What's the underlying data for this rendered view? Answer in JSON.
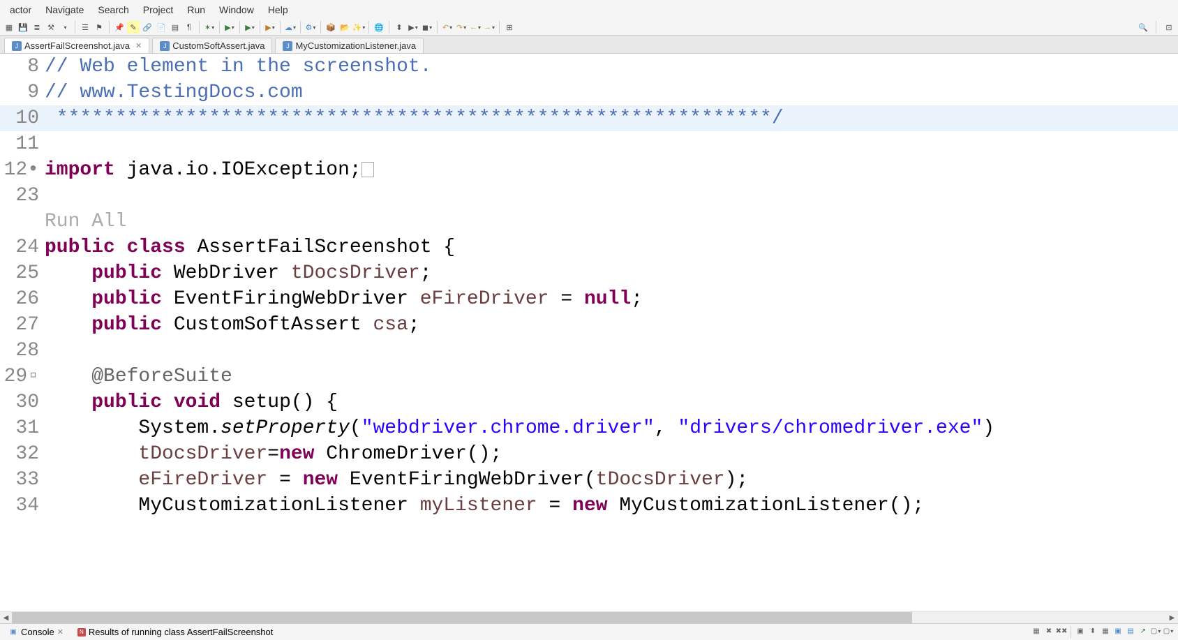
{
  "menu": [
    "actor",
    "Navigate",
    "Search",
    "Project",
    "Run",
    "Window",
    "Help"
  ],
  "tabs": [
    {
      "label": "AssertFailScreenshot.java",
      "active": true,
      "closeable": true
    },
    {
      "label": "CustomSoftAssert.java",
      "active": false,
      "closeable": false
    },
    {
      "label": "MyCustomizationListener.java",
      "active": false,
      "closeable": false
    }
  ],
  "code": {
    "lines": [
      {
        "n": "8",
        "type": "comment",
        "text": "// Web element in the screenshot."
      },
      {
        "n": "9",
        "type": "comment",
        "text": "// www.TestingDocs.com"
      },
      {
        "n": "10",
        "type": "comment-current",
        "text": " *************************************************************/"
      },
      {
        "n": "11",
        "type": "blank",
        "text": ""
      },
      {
        "n": "12•",
        "type": "import",
        "kw": "import",
        "rest": " java.io.IOException;",
        "box": true
      },
      {
        "n": "23",
        "type": "blank",
        "text": ""
      },
      {
        "n": "",
        "type": "hint",
        "text": "Run All"
      },
      {
        "n": "24",
        "type": "class",
        "tokens": [
          {
            "t": "public ",
            "c": "kw"
          },
          {
            "t": "class ",
            "c": "kw"
          },
          {
            "t": "AssertFailScreenshot {",
            "c": "type"
          }
        ]
      },
      {
        "n": "25",
        "type": "field",
        "tokens": [
          {
            "t": "    ",
            "c": "type"
          },
          {
            "t": "public ",
            "c": "kw"
          },
          {
            "t": "WebDriver ",
            "c": "type"
          },
          {
            "t": "tDocsDriver",
            "c": "var"
          },
          {
            "t": ";",
            "c": "type"
          }
        ]
      },
      {
        "n": "26",
        "type": "field",
        "tokens": [
          {
            "t": "    ",
            "c": "type"
          },
          {
            "t": "public ",
            "c": "kw"
          },
          {
            "t": "EventFiringWebDriver ",
            "c": "type"
          },
          {
            "t": "eFireDriver",
            "c": "var"
          },
          {
            "t": " = ",
            "c": "type"
          },
          {
            "t": "null",
            "c": "kw"
          },
          {
            "t": ";",
            "c": "type"
          }
        ]
      },
      {
        "n": "27",
        "type": "field",
        "tokens": [
          {
            "t": "    ",
            "c": "type"
          },
          {
            "t": "public ",
            "c": "kw"
          },
          {
            "t": "CustomSoftAssert ",
            "c": "type"
          },
          {
            "t": "csa",
            "c": "var"
          },
          {
            "t": ";",
            "c": "type"
          }
        ]
      },
      {
        "n": "28",
        "type": "blank",
        "text": ""
      },
      {
        "n": "29▫",
        "type": "ann",
        "tokens": [
          {
            "t": "    @BeforeSuite",
            "c": "ann"
          }
        ]
      },
      {
        "n": "30",
        "type": "method",
        "tokens": [
          {
            "t": "    ",
            "c": "type"
          },
          {
            "t": "public ",
            "c": "kw"
          },
          {
            "t": "void ",
            "c": "kw"
          },
          {
            "t": "setup() {",
            "c": "type"
          }
        ]
      },
      {
        "n": "31",
        "type": "stmt",
        "tokens": [
          {
            "t": "        System.",
            "c": "type"
          },
          {
            "t": "setProperty",
            "c": "meth-i"
          },
          {
            "t": "(",
            "c": "type"
          },
          {
            "t": "\"webdriver.chrome.driver\"",
            "c": "str"
          },
          {
            "t": ", ",
            "c": "type"
          },
          {
            "t": "\"drivers/chromedriver.exe\"",
            "c": "str"
          },
          {
            "t": ")",
            "c": "type"
          }
        ]
      },
      {
        "n": "32",
        "type": "stmt",
        "tokens": [
          {
            "t": "        ",
            "c": "type"
          },
          {
            "t": "tDocsDriver",
            "c": "var"
          },
          {
            "t": "=",
            "c": "type"
          },
          {
            "t": "new ",
            "c": "kw"
          },
          {
            "t": "ChromeDriver();",
            "c": "type"
          }
        ]
      },
      {
        "n": "33",
        "type": "stmt",
        "tokens": [
          {
            "t": "        ",
            "c": "type"
          },
          {
            "t": "eFireDriver",
            "c": "var"
          },
          {
            "t": " = ",
            "c": "type"
          },
          {
            "t": "new ",
            "c": "kw"
          },
          {
            "t": "EventFiringWebDriver(",
            "c": "type"
          },
          {
            "t": "tDocsDriver",
            "c": "var"
          },
          {
            "t": ");",
            "c": "type"
          }
        ]
      },
      {
        "n": "34",
        "type": "stmt",
        "tokens": [
          {
            "t": "        MyCustomizationListener ",
            "c": "type"
          },
          {
            "t": "myListener",
            "c": "var"
          },
          {
            "t": " = ",
            "c": "type"
          },
          {
            "t": "new ",
            "c": "kw"
          },
          {
            "t": "MyCustomizationListener();",
            "c": "type"
          }
        ]
      }
    ]
  },
  "console_tabs": [
    {
      "icon": "□",
      "label": "Console",
      "closeable": true
    },
    {
      "icon": "N",
      "label": "Results of running class AssertFailScreenshot",
      "closeable": false
    }
  ]
}
